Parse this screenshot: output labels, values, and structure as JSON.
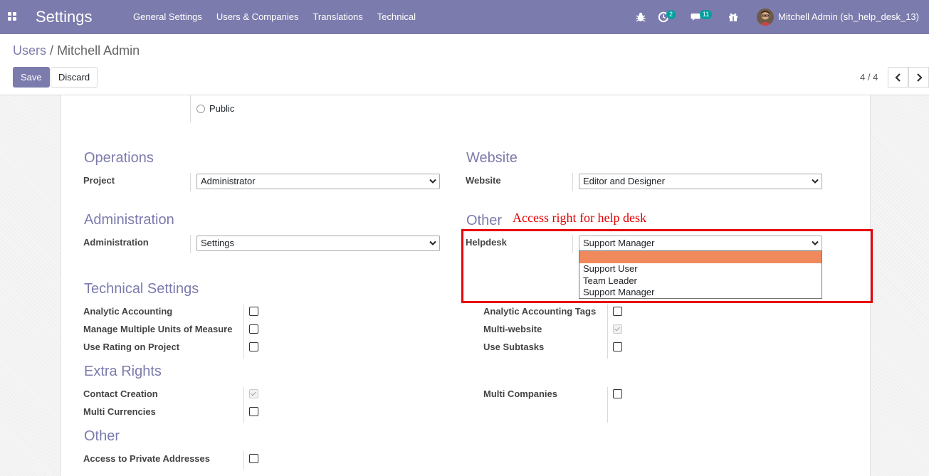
{
  "navbar": {
    "brand": "Settings",
    "menu": [
      "General Settings",
      "Users & Companies",
      "Translations",
      "Technical"
    ],
    "activity_count": "2",
    "messages_count": "11",
    "user": "Mitchell Admin (sh_help_desk_13)",
    "color": "#7c7bad"
  },
  "breadcrumb": {
    "parent": "Users",
    "separator": "/",
    "current": "Mitchell Admin"
  },
  "buttons": {
    "save": "Save",
    "discard": "Discard"
  },
  "pager": {
    "value": "4 / 4"
  },
  "user_type": {
    "option_public": "Public"
  },
  "sections": {
    "operations": {
      "title": "Operations",
      "project_label": "Project",
      "project_value": "Administrator"
    },
    "website": {
      "title": "Website",
      "website_label": "Website",
      "website_value": "Editor and Designer"
    },
    "administration": {
      "title": "Administration",
      "label": "Administration",
      "value": "Settings"
    },
    "other_top": {
      "title": "Other",
      "helpdesk_label": "Helpdesk",
      "helpdesk_value": "Support Manager"
    },
    "technical": {
      "title": "Technical Settings",
      "left": [
        {
          "label": "Analytic Accounting",
          "checked": false
        },
        {
          "label": "Manage Multiple Units of Measure",
          "checked": false
        },
        {
          "label": "Use Rating on Project",
          "checked": false
        }
      ],
      "right": [
        {
          "label": "Analytic Accounting Tags",
          "checked": false
        },
        {
          "label": "Multi-website",
          "checked": true
        },
        {
          "label": "Use Subtasks",
          "checked": false
        }
      ]
    },
    "extra_rights": {
      "title": "Extra Rights",
      "left": [
        {
          "label": "Contact Creation",
          "checked": true
        },
        {
          "label": "Multi Currencies",
          "checked": false
        }
      ],
      "right": [
        {
          "label": "Multi Companies",
          "checked": false
        }
      ]
    },
    "other_bottom": {
      "title": "Other",
      "items": [
        {
          "label": "Access to Private Addresses",
          "checked": false
        }
      ]
    }
  },
  "helpdesk_dropdown": {
    "options": [
      "",
      "Support User",
      "Team Leader",
      "Support Manager"
    ],
    "highlight_color": "#f08a5d"
  },
  "annotation": {
    "text": "Access right for help desk",
    "color": "#e30000"
  }
}
